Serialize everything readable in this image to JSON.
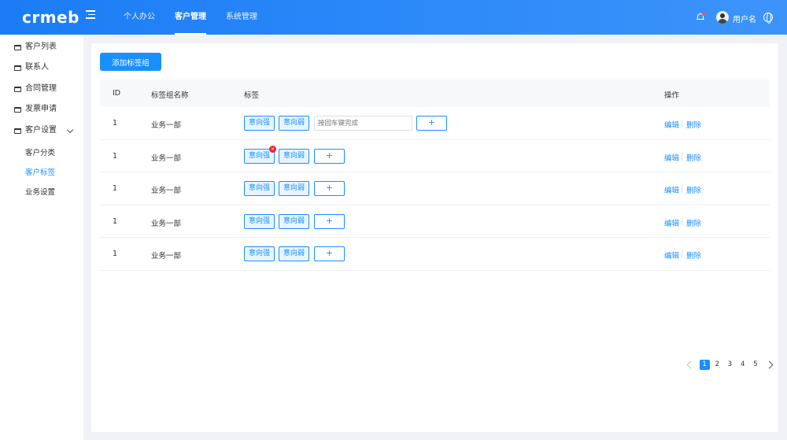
{
  "header": {
    "logo": "crmeb",
    "nav": [
      "个人办公",
      "客户管理",
      "系统管理"
    ],
    "active_nav": "客户管理",
    "username": "用户名"
  },
  "sidebar": {
    "items": [
      "客户列表",
      "联系人",
      "合同管理",
      "发票申请",
      "客户设置"
    ],
    "sub_items": [
      "客户分类",
      "客户标签",
      "业务设置"
    ],
    "active_sub": "客户标签"
  },
  "toolbar": {
    "add_label": "添加标签组"
  },
  "table": {
    "columns": [
      "ID",
      "标签组名称",
      "标签",
      "操作"
    ],
    "rows": [
      {
        "id": "1",
        "name": "业务一部",
        "tags": [
          "意向强",
          "意向弱"
        ]
      },
      {
        "id": "1",
        "name": "业务一部",
        "tags": [
          "意向强",
          "意向弱"
        ]
      },
      {
        "id": "1",
        "name": "业务一部",
        "tags": [
          "意向强",
          "意向弱"
        ]
      },
      {
        "id": "1",
        "name": "业务一部",
        "tags": [
          "意向强",
          "意向弱"
        ]
      },
      {
        "id": "1",
        "name": "业务一部",
        "tags": [
          "意向强",
          "意向弱"
        ]
      }
    ],
    "tag_input_placeholder": "按回车键完成",
    "add_tag": "+",
    "remove_tag": "×",
    "edit_label": "编辑",
    "delete_label": "删除"
  },
  "pagination": {
    "pages": [
      "1",
      "2",
      "3",
      "4",
      "5"
    ],
    "current": "1"
  },
  "colors": {
    "primary": "#1890ff",
    "header_start": "#1b7cf5",
    "header_end": "#3c94fb",
    "danger": "#f5222d"
  }
}
